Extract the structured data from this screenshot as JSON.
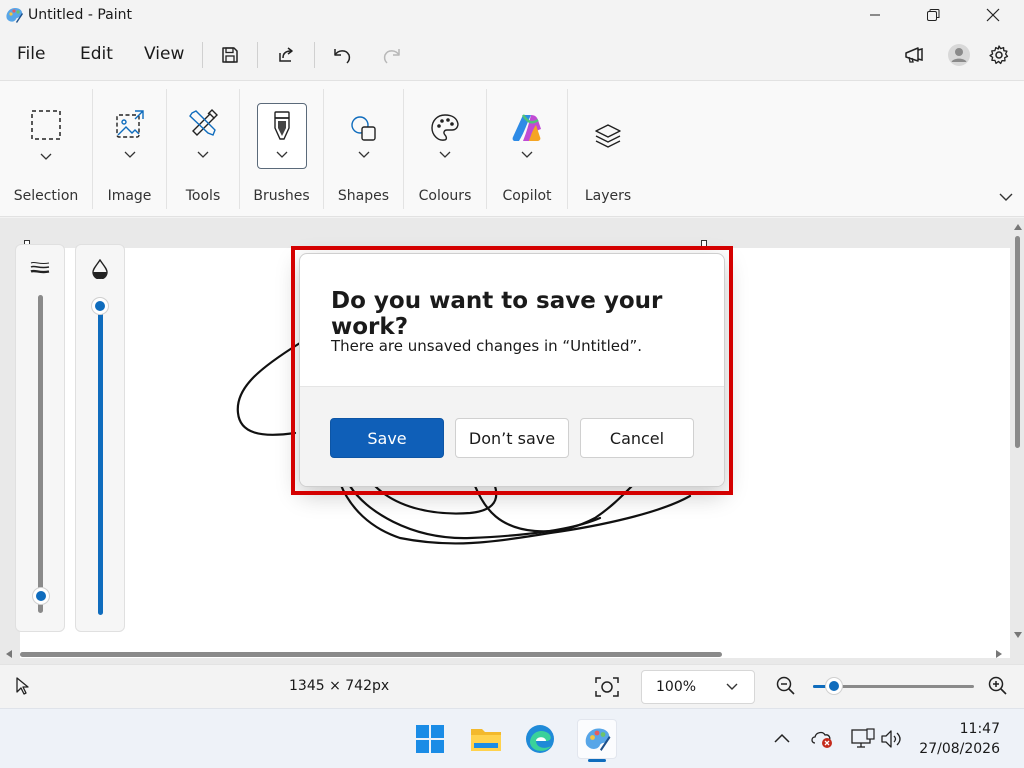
{
  "window": {
    "title": "Untitled - Paint"
  },
  "menu": {
    "file": "File",
    "edit": "Edit",
    "view": "View"
  },
  "ribbon": {
    "groups": [
      "Selection",
      "Image",
      "Tools",
      "Brushes",
      "Shapes",
      "Colours",
      "Copilot",
      "Layers"
    ]
  },
  "dialog": {
    "title": "Do you want to save your work?",
    "message": "There are unsaved changes in “Untitled”.",
    "save": "Save",
    "dont_save": "Don’t save",
    "cancel": "Cancel"
  },
  "status": {
    "dimensions": "1345 × 742px",
    "zoom": "100%",
    "zoom_level": 0.13
  },
  "taskbar": {
    "time": "11:47",
    "date": "27/08/2026"
  },
  "colors": {
    "accent": "#0f5fb8",
    "highlight": "#d40000"
  },
  "icons": [
    "paint-app-icon",
    "minimize-icon",
    "maximize-icon",
    "close-icon",
    "save-icon",
    "share-icon",
    "undo-icon",
    "redo-icon",
    "feedback-icon",
    "account-icon",
    "settings-icon"
  ]
}
